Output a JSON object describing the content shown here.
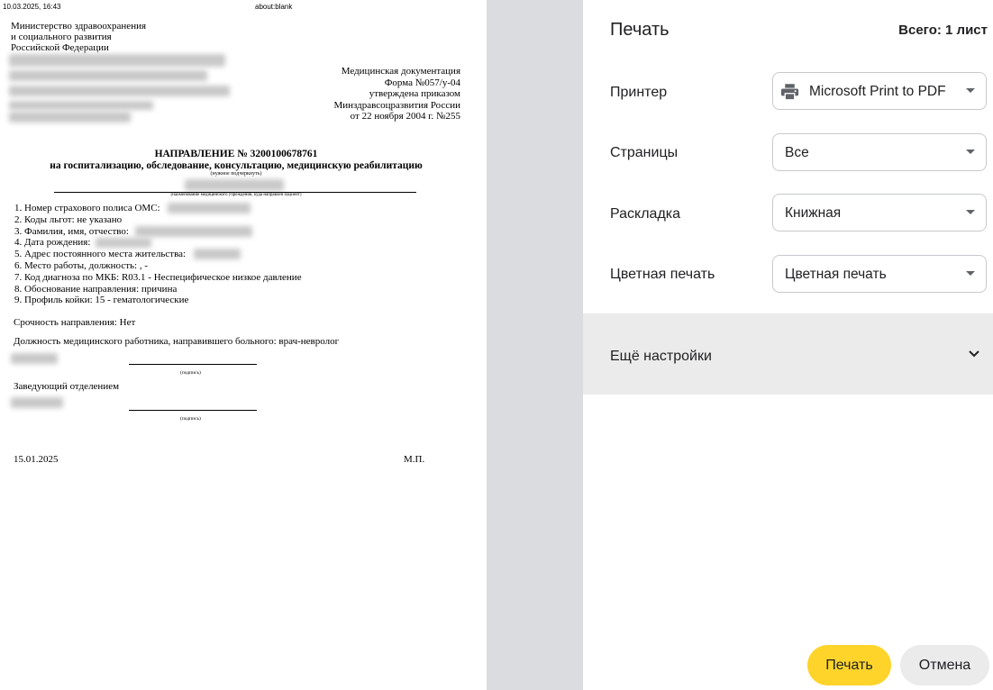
{
  "document": {
    "header_datetime": "10.03.2025, 16:43",
    "header_url": "about:blank",
    "ministry": [
      "Министерство здравоохранения",
      "и социального развития",
      "Российской Федерации"
    ],
    "doc_info": [
      "Медицинская документация",
      "Форма №057/у-04",
      "утверждена приказом",
      "Минздравсоцразвития России",
      "от 22 ноября 2004 г. №255"
    ],
    "title": "НАПРАВЛЕНИЕ № 3200100678761",
    "subtitle": "на госпитализацию, обследование, консультацию, медицинскую реабилитацию",
    "subtitle_note": "(нужное подчеркнуть)",
    "institution_caption": "(наименование медицинского учреждения, куда направлен пациент)",
    "items": [
      "1. Номер страхового полиса ОМС:",
      "2. Коды льгот: не указано",
      "3. Фамилия, имя, отчество:",
      "4. Дата рождения:",
      "5. Адрес постоянного места жительства:",
      "6. Место работы, должность: , -",
      "7. Код диагноза по МКБ: R03.1 - Неспецифическое низкое давление",
      "8. Обоснование направления: причина",
      "9. Профиль койки: 15 - гематологические"
    ],
    "urgency": "Срочность направления: Нет",
    "doctor_position": "Должность медицинского работника, направившего больного: врач-невролог",
    "signature_caption": "(подпись)",
    "head_of_department": "Заведующий отделением",
    "date": "15.01.2025",
    "stamp": "М.П."
  },
  "panel": {
    "title": "Печать",
    "sheet_count": "Всего: 1 лист",
    "printer_label": "Принтер",
    "printer_value": "Microsoft Print to PDF",
    "pages_label": "Страницы",
    "pages_value": "Все",
    "layout_label": "Раскладка",
    "layout_value": "Книжная",
    "color_label": "Цветная печать",
    "color_value": "Цветная печать",
    "more_settings": "Ещё настройки",
    "print_button": "Печать",
    "cancel_button": "Отмена"
  },
  "colors": {
    "print_button": "#fed42b",
    "cancel_button": "#ebebeb",
    "preview_background": "#dadce0",
    "more_settings_background": "#ebebeb"
  },
  "icons": {
    "printer": "printer-icon",
    "dropdown": "caret-down-icon",
    "expand": "chevron-down-icon"
  }
}
